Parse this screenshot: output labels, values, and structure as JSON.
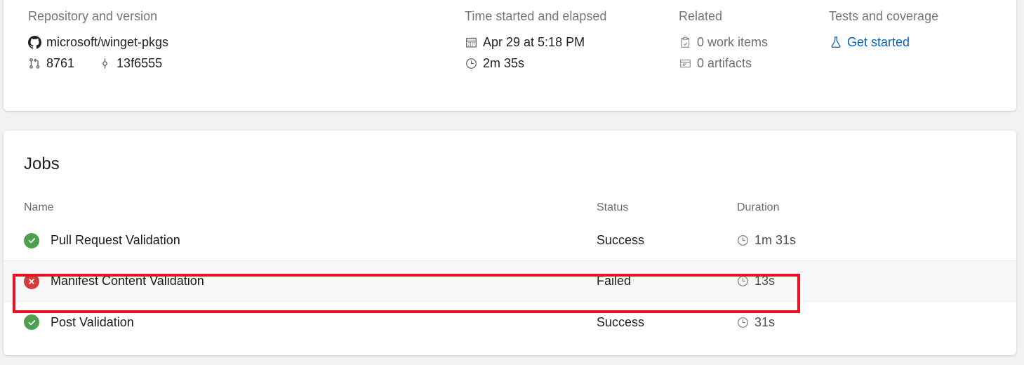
{
  "summary": {
    "repository": {
      "label": "Repository and version",
      "icon": "github-icon",
      "repo_name": "microsoft/winget-pkgs",
      "pull_request_icon": "pull-request-icon",
      "pull_request_number": "8761",
      "commit_icon": "commit-icon",
      "commit_hash": "13f6555"
    },
    "time": {
      "label": "Time started and elapsed",
      "calendar_icon": "calendar-icon",
      "started": "Apr 29 at 5:18 PM",
      "clock_icon": "clock-icon",
      "elapsed": "2m 35s"
    },
    "related": {
      "label": "Related",
      "work_items_icon": "work-item-icon",
      "work_items": "0 work items",
      "artifacts_icon": "artifact-icon",
      "artifacts": "0 artifacts"
    },
    "tests": {
      "label": "Tests and coverage",
      "flask_icon": "flask-icon",
      "link_label": "Get started"
    }
  },
  "jobs": {
    "title": "Jobs",
    "columns": {
      "name": "Name",
      "status": "Status",
      "duration": "Duration"
    },
    "rows": [
      {
        "status_icon": "success-icon",
        "status_type": "success",
        "name": "Pull Request Validation",
        "status": "Success",
        "duration_icon": "clock-icon",
        "duration": "1m 31s",
        "highlighted": false
      },
      {
        "status_icon": "failed-icon",
        "status_type": "failed",
        "name": "Manifest Content Validation",
        "status": "Failed",
        "duration_icon": "clock-icon",
        "duration": "13s",
        "highlighted": true
      },
      {
        "status_icon": "success-icon",
        "status_type": "success",
        "name": "Post Validation",
        "status": "Success",
        "duration_icon": "clock-icon",
        "duration": "31s",
        "highlighted": false
      }
    ]
  },
  "annotation": {
    "name": "highlight-box",
    "color": "#e81123",
    "targets": "Manifest Content Validation"
  },
  "colors": {
    "link": "#0a62b0",
    "success": "#4e9f4e",
    "failed": "#cf3f3f",
    "annotation": "#e81123",
    "muted_text": "#767676",
    "card_background": "#ffffff",
    "page_background": "#f2f2f2"
  }
}
